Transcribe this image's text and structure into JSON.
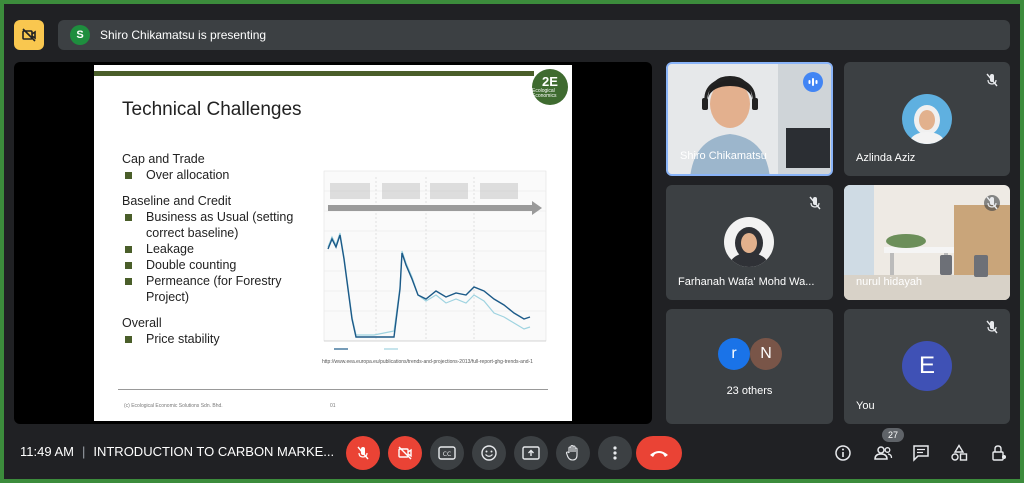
{
  "presenting": {
    "avatar_letter": "S",
    "text": "Shiro Chikamatsu is presenting"
  },
  "slide": {
    "logo_text": "2E",
    "logo_sub": "Ecological Economics",
    "title": "Technical Challenges",
    "sections": [
      {
        "heading": "Cap and Trade",
        "bullets": [
          "Over allocation"
        ]
      },
      {
        "heading": "Baseline and Credit",
        "bullets": [
          "Business as Usual (setting correct baseline)",
          "Leakage",
          "Double counting",
          "Permeance (for Forestry Project)"
        ]
      },
      {
        "heading": "Overall",
        "bullets": [
          "Price stability"
        ]
      }
    ],
    "url": "http://www.eea.europa.eu/publications/trends-and-projections-2013/full-report-ghg-trends-and-1",
    "footer": "(c) Ecological Economic Solutions Sdn. Bhd.",
    "page": "01"
  },
  "participants": {
    "shiro": {
      "name": "Shiro Chikamatsu"
    },
    "azlinda": {
      "name": "Azlinda Aziz"
    },
    "farhanah": {
      "name": "Farhanah Wafa' Mohd Wa..."
    },
    "nurul": {
      "name": "nurul hidayah"
    },
    "others": {
      "letters": [
        "r",
        "N"
      ],
      "label": "23 others"
    },
    "you": {
      "letter": "E",
      "name": "You"
    }
  },
  "bottom": {
    "time": "11:49 AM",
    "meeting_title": "INTRODUCTION TO CARBON MARKE...",
    "people_count": "27"
  },
  "colors": {
    "accent_green": "#3c8c3c",
    "danger_red": "#ea4335",
    "presenter_yellow": "#f9c74f",
    "speaking_blue": "#4285f4"
  }
}
